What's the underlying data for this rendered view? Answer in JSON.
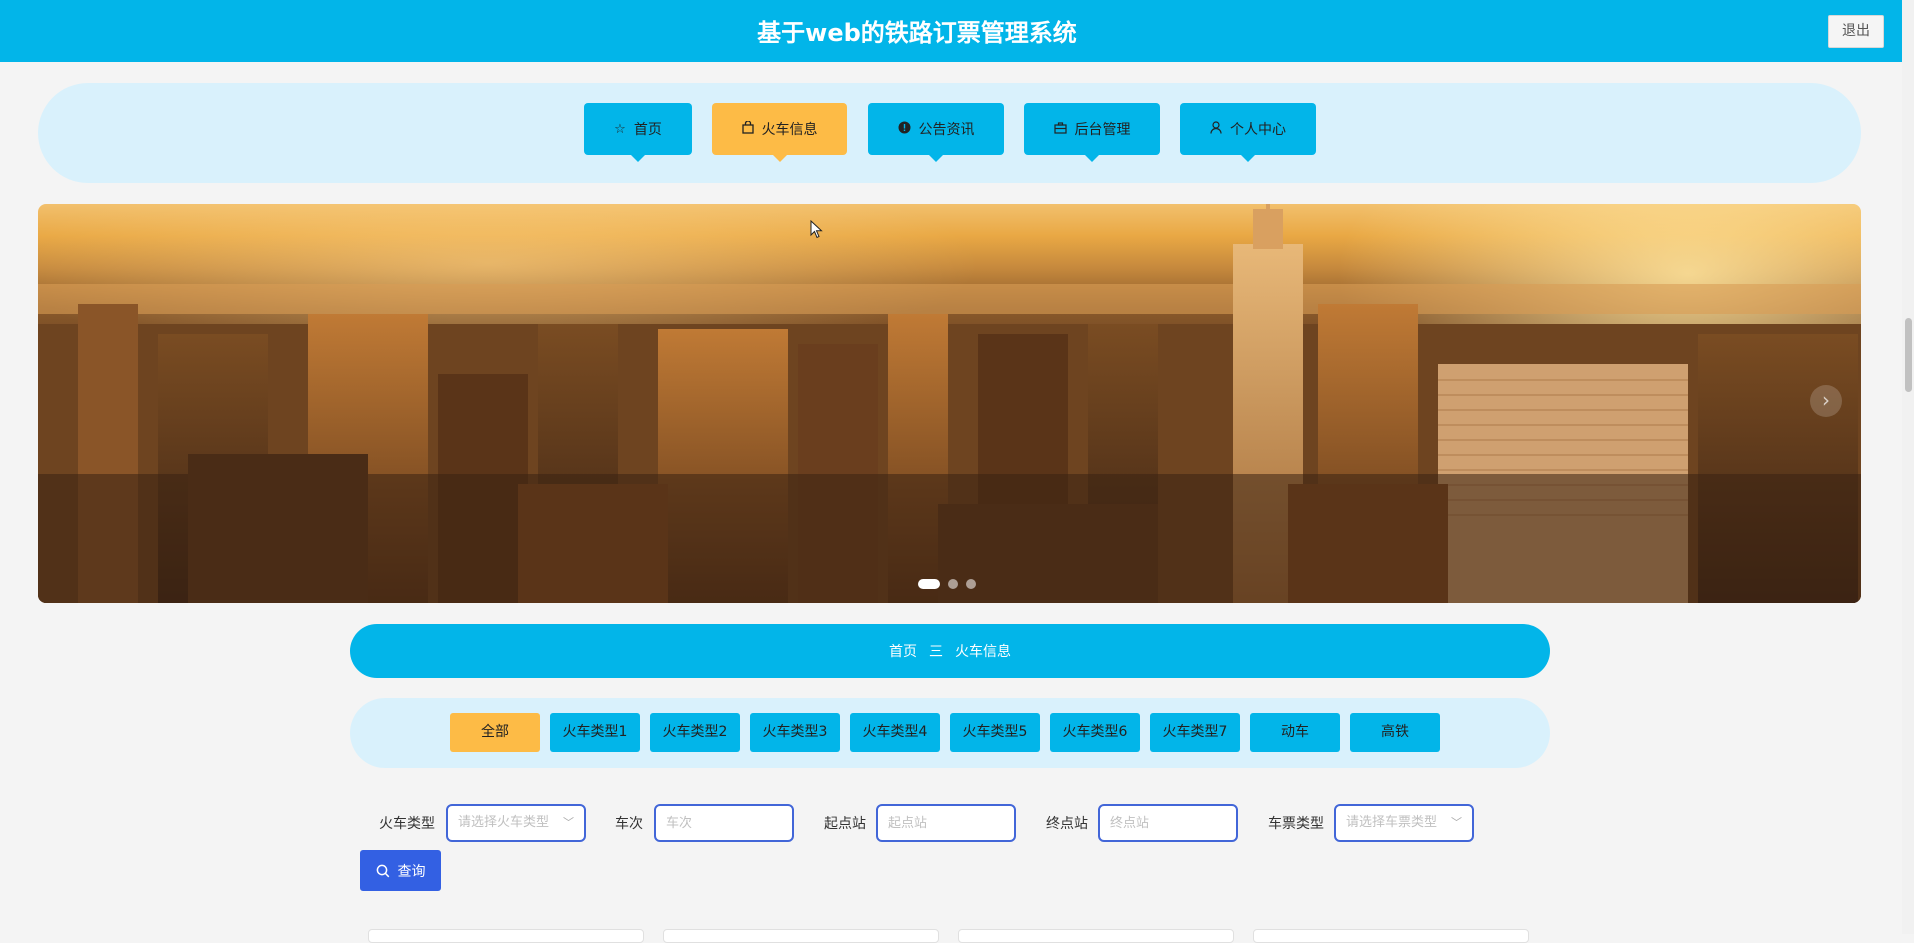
{
  "header": {
    "title": "基于web的铁路订票管理系统",
    "logout_label": "退出"
  },
  "nav": {
    "items": [
      {
        "label": "首页",
        "icon": "star-icon",
        "active": false
      },
      {
        "label": "火车信息",
        "icon": "bag-icon",
        "active": true
      },
      {
        "label": "公告资讯",
        "icon": "info-icon",
        "active": false
      },
      {
        "label": "后台管理",
        "icon": "briefcase-icon",
        "active": false
      },
      {
        "label": "个人中心",
        "icon": "user-icon",
        "active": false
      }
    ]
  },
  "banner": {
    "slide_count": 3,
    "active_slide": 1,
    "next_icon": "chevron-right-icon"
  },
  "breadcrumb": {
    "home": "首页",
    "separator": "三",
    "current": "火车信息"
  },
  "categories": [
    {
      "label": "全部",
      "active": true
    },
    {
      "label": "火车类型1",
      "active": false
    },
    {
      "label": "火车类型2",
      "active": false
    },
    {
      "label": "火车类型3",
      "active": false
    },
    {
      "label": "火车类型4",
      "active": false
    },
    {
      "label": "火车类型5",
      "active": false
    },
    {
      "label": "火车类型6",
      "active": false
    },
    {
      "label": "火车类型7",
      "active": false
    },
    {
      "label": "动车",
      "active": false
    },
    {
      "label": "高铁",
      "active": false
    }
  ],
  "filters": {
    "train_type": {
      "label": "火车类型",
      "placeholder": "请选择火车类型"
    },
    "train_no": {
      "label": "车次",
      "placeholder": "车次"
    },
    "start_station": {
      "label": "起点站",
      "placeholder": "起点站"
    },
    "end_station": {
      "label": "终点站",
      "placeholder": "终点站"
    },
    "ticket_type": {
      "label": "车票类型",
      "placeholder": "请选择车票类型"
    },
    "search_label": "查询"
  },
  "colors": {
    "primary": "#02b5e9",
    "accent": "#fdbb46",
    "button": "#3360e3",
    "nav_band": "#d9f1fc"
  }
}
